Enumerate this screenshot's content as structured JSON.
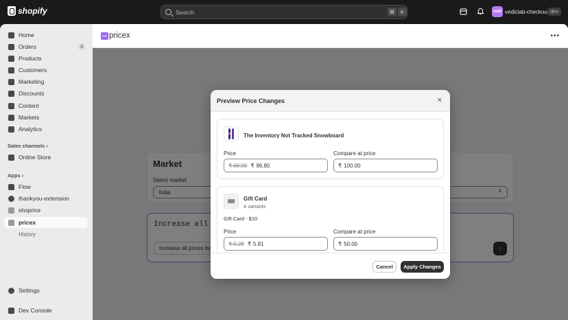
{
  "topbar": {
    "brand": "shopify",
    "search_placeholder": "Search",
    "kbd_cmd": "⌘",
    "kbd_k": "K",
    "store_initials": "vedi",
    "store_name": "vediclab-checkout",
    "env_badge": "dev"
  },
  "sidebar": {
    "items": [
      {
        "label": "Home",
        "icon": "home-icon"
      },
      {
        "label": "Orders",
        "icon": "orders-icon",
        "badge": "3"
      },
      {
        "label": "Products",
        "icon": "tag-icon"
      },
      {
        "label": "Customers",
        "icon": "person-icon"
      },
      {
        "label": "Marketing",
        "icon": "target-icon"
      },
      {
        "label": "Discounts",
        "icon": "discount-icon"
      },
      {
        "label": "Content",
        "icon": "content-icon"
      },
      {
        "label": "Markets",
        "icon": "globe-icon"
      },
      {
        "label": "Analytics",
        "icon": "chart-icon"
      }
    ],
    "sales_channels_header": "Sales channels",
    "sales_channels": [
      {
        "label": "Online Store"
      }
    ],
    "apps_header": "Apps",
    "apps": [
      {
        "label": "Flow"
      },
      {
        "label": "thankyou-extension"
      },
      {
        "label": "shoprice"
      },
      {
        "label": "pricex"
      }
    ],
    "app_sub_items": [
      {
        "label": "History"
      }
    ],
    "settings": "Settings",
    "dev_console": "Dev Console"
  },
  "app_header": {
    "title": "pricex"
  },
  "background": {
    "market_title": "Market",
    "select_market_label": "Select market",
    "select_market_value": "India",
    "rule_text": "Increase all pri",
    "action_button": "Increase all prices by"
  },
  "modal": {
    "title": "Preview Price Changes",
    "products": [
      {
        "name": "The Inventory Not Tracked Snowboard",
        "price_label": "Price",
        "compare_label": "Compare at price",
        "old_price": "₹ 88.00",
        "currency": "₹",
        "new_price": "96.80",
        "compare_currency": "₹",
        "compare_price": "100.00"
      },
      {
        "name": "Gift Card",
        "variants": "4 variants",
        "variant_name": "Gift Card - $10",
        "price_label": "Price",
        "compare_label": "Compare at price",
        "old_price": "₹ 5.28",
        "currency": "₹",
        "new_price": "5.81",
        "compare_currency": "₹",
        "compare_price": "50.00"
      }
    ],
    "cancel_label": "Cancel",
    "apply_label": "Apply Changes"
  }
}
